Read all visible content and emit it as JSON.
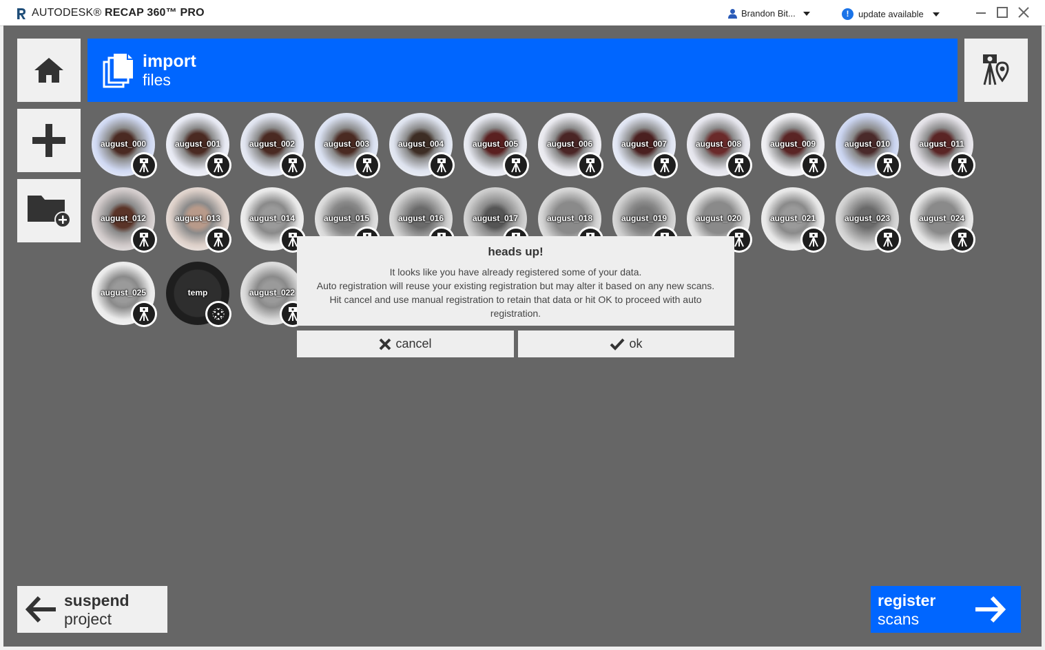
{
  "app": {
    "brand": "AUTODESK®",
    "product": "RECAP 360™ PRO"
  },
  "header": {
    "user_name": "Brandon Bit...",
    "update_label": "update available"
  },
  "sidebar": {
    "home": "home",
    "add": "add",
    "add_folder": "add folder"
  },
  "import": {
    "line1": "import",
    "line2": "files"
  },
  "scans": [
    {
      "label": "august_000",
      "tone": "#cfd8f2",
      "core": "#4a2a22"
    },
    {
      "label": "august_001",
      "tone": "#e6e8f2",
      "core": "#4a2a22"
    },
    {
      "label": "august_002",
      "tone": "#dfe3ef",
      "core": "#4a2a22"
    },
    {
      "label": "august_003",
      "tone": "#d8dff0",
      "core": "#4a2a22"
    },
    {
      "label": "august_004",
      "tone": "#dde2ee",
      "core": "#3d2d24"
    },
    {
      "label": "august_005",
      "tone": "#e4e6ee",
      "core": "#5a2020"
    },
    {
      "label": "august_006",
      "tone": "#e8e8ee",
      "core": "#4a2525"
    },
    {
      "label": "august_007",
      "tone": "#dfe4f2",
      "core": "#4a2020"
    },
    {
      "label": "august_008",
      "tone": "#e4e4ec",
      "core": "#6a2a2a"
    },
    {
      "label": "august_009",
      "tone": "#ececf0",
      "core": "#5a2525"
    },
    {
      "label": "august_010",
      "tone": "#c9d3ef",
      "core": "#4a2a2a"
    },
    {
      "label": "august_011",
      "tone": "#e2e0e6",
      "core": "#5a2525"
    },
    {
      "label": "august_012",
      "tone": "#cfc8c8",
      "core": "#5a3428"
    },
    {
      "label": "august_013",
      "tone": "#dccfc8",
      "core": "#b89a8a"
    },
    {
      "label": "august_014",
      "tone": "#e8e8e8",
      "core": "#9a9a9a"
    },
    {
      "label": "august_015",
      "tone": "#d8d8d8",
      "core": "#7a7a7a"
    },
    {
      "label": "august_016",
      "tone": "#d0d0d0",
      "core": "#6a6a6a"
    },
    {
      "label": "august_017",
      "tone": "#c8c8c8",
      "core": "#555555"
    },
    {
      "label": "august_018",
      "tone": "#d2d2d2",
      "core": "#8a8a8a"
    },
    {
      "label": "august_019",
      "tone": "#cccccc",
      "core": "#777777"
    },
    {
      "label": "august_020",
      "tone": "#e0e0e0",
      "core": "#8a8a8a"
    },
    {
      "label": "august_021",
      "tone": "#e6e6e6",
      "core": "#9a9a9a"
    },
    {
      "label": "august_023",
      "tone": "#cfcfcf",
      "core": "#6a6a6a"
    },
    {
      "label": "august_024",
      "tone": "#e2e2e2",
      "core": "#8a8a8a"
    },
    {
      "label": "august_025",
      "tone": "#eaeaea",
      "core": "#9a9a9a"
    },
    {
      "label": "temp",
      "tone": "#1e1e1e",
      "core": "#2e2e2e"
    },
    {
      "label": "august_022",
      "tone": "#d8d8d8",
      "core": "#9a9a9a"
    }
  ],
  "dialog": {
    "title": "heads up!",
    "line1": "It looks like you have already registered some of your data.",
    "line2": "Auto registration will reuse your existing registration but may alter it based on any new scans.",
    "line3": "Hit cancel and use manual registration to retain that data or hit OK to proceed with auto",
    "line4": "registration.",
    "cancel_label": "cancel",
    "ok_label": "ok"
  },
  "footer": {
    "suspend_line1": "suspend",
    "suspend_line2": "project",
    "register_line1": "register",
    "register_line2": "scans"
  },
  "colors": {
    "accent": "#0066ff",
    "workspace": "#666666",
    "panel": "#f0f0f0",
    "info": "#1a73e8"
  }
}
